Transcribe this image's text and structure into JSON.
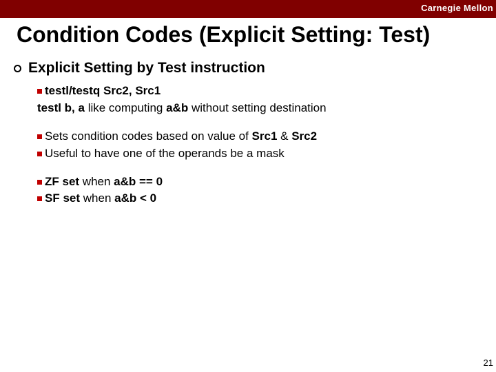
{
  "header": {
    "brand": "Carnegie Mellon"
  },
  "title": "Condition Codes (Explicit Setting: Test)",
  "section": {
    "heading": "Explicit Setting by Test instruction"
  },
  "g1": {
    "line1_code": "testl/testq Src2, Src1",
    "line2_code": "testl b, a",
    "line2_mid": " like computing ",
    "line2_em": "a&b",
    "line2_tail": " without setting destination"
  },
  "g2": {
    "line1_a": "Sets condition codes based on value of ",
    "line1_b": "Src1",
    "line1_amp": " & ",
    "line1_c": "Src2",
    "line2": "Useful to have one of the operands be a mask"
  },
  "g3": {
    "line1_a": "ZF set",
    "line1_b": " when ",
    "line1_c": "a&b == 0",
    "line2_a": "SF set",
    "line2_b": " when ",
    "line2_c": "a&b < 0"
  },
  "page": "21"
}
